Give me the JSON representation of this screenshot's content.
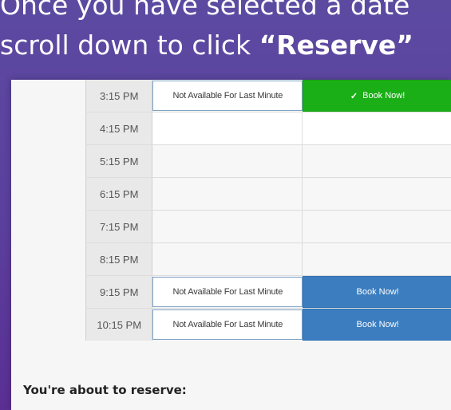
{
  "headline": {
    "line1": "Once you have selected a date",
    "line2_prefix": "scroll down to click ",
    "line2_bold": "“Reserve”"
  },
  "schedule": {
    "rows": [
      {
        "time": "3:15 PM",
        "slot1": "Not Available For Last Minute",
        "slot2": "Book Now!",
        "slot2_state": "selected",
        "check": "✓"
      },
      {
        "time": "4:15 PM",
        "slot1": "",
        "slot2": "",
        "slot2_state": "empty"
      },
      {
        "time": "5:15 PM",
        "slot1": "",
        "slot2": "",
        "slot2_state": "empty"
      },
      {
        "time": "6:15 PM",
        "slot1": "",
        "slot2": "",
        "slot2_state": "empty"
      },
      {
        "time": "7:15 PM",
        "slot1": "",
        "slot2": "",
        "slot2_state": "empty"
      },
      {
        "time": "8:15 PM",
        "slot1": "",
        "slot2": "",
        "slot2_state": "empty"
      },
      {
        "time": "9:15 PM",
        "slot1": "Not Available For Last Minute",
        "slot2": "Book Now!",
        "slot2_state": "available"
      },
      {
        "time": "10:15 PM",
        "slot1": "Not Available For Last Minute",
        "slot2": "Book Now!",
        "slot2_state": "available"
      }
    ]
  },
  "reserve_section": {
    "title": "You're about to reserve:"
  },
  "colors": {
    "background": "#5b3f9d",
    "book_blue": "#3b7dbf",
    "book_green": "#1aaf16"
  }
}
